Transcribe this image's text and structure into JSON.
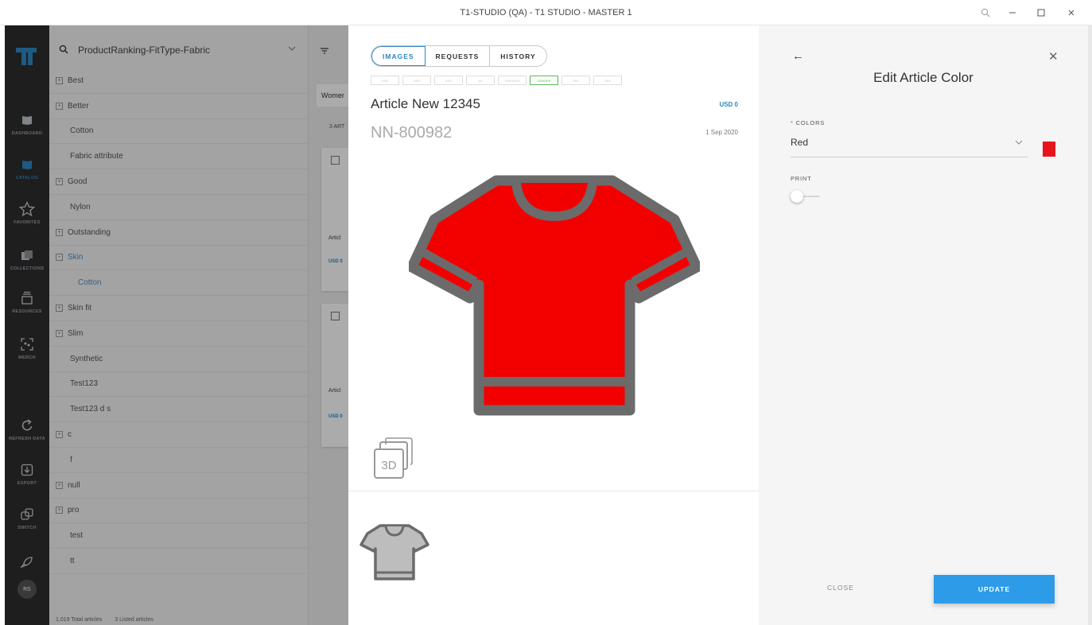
{
  "window": {
    "title": "T1-STUDIO (QA) - T1 STUDIO - MASTER 1"
  },
  "rail": {
    "items": [
      {
        "label": "DASHBOARD"
      },
      {
        "label": "CATALOG"
      },
      {
        "label": "FAVORITES"
      },
      {
        "label": "COLLECTIONS"
      },
      {
        "label": "RESOURCES"
      },
      {
        "label": "MERCH"
      },
      {
        "label": "REFRESH DATA"
      },
      {
        "label": "EXPORT"
      },
      {
        "label": "SWITCH"
      }
    ],
    "avatar": "RS"
  },
  "tree": {
    "search_value": "ProductRanking-FitType-Fabric",
    "items": [
      {
        "label": "Best"
      },
      {
        "label": "Better"
      },
      {
        "label": "Cotton"
      },
      {
        "label": "Fabric attribute"
      },
      {
        "label": "Good"
      },
      {
        "label": "Nylon"
      },
      {
        "label": "Outstanding"
      },
      {
        "label": "Skin"
      },
      {
        "label": "Cotton"
      },
      {
        "label": "Skin fit"
      },
      {
        "label": "Slim"
      },
      {
        "label": "Synthetic"
      },
      {
        "label": "Test123"
      },
      {
        "label": "Test123 d s"
      },
      {
        "label": "c"
      },
      {
        "label": "f"
      },
      {
        "label": "null"
      },
      {
        "label": "pro"
      },
      {
        "label": "test"
      },
      {
        "label": "tt"
      }
    ],
    "footer_total": "1,019 Total articles",
    "footer_listed": "3 Listed articles"
  },
  "midcol": {
    "segment": "Womer",
    "count": "3 ART",
    "card1": {
      "name": "Articl",
      "price": "USD 0"
    },
    "card2": {
      "name": "Articl",
      "price": "USD 0"
    }
  },
  "article": {
    "tabs": [
      "IMAGES",
      "REQUESTS",
      "HISTORY"
    ],
    "active_tab": "IMAGES",
    "chips": [
      "XXX",
      "XXX",
      "XXX",
      "XX",
      "XXXXXXX",
      "GENDER",
      "XXX",
      "XXX"
    ],
    "active_chip": "GENDER",
    "title": "Article New 12345",
    "price": "USD 0",
    "code": "NN-800982",
    "date": "1 Sep 2020",
    "badge_3d": "3D",
    "colors": {
      "shirt": "#f20000",
      "outline": "#6b6b6b",
      "thumb_fill": "#bdbdbd"
    }
  },
  "edit": {
    "title": "Edit Article Color",
    "colors_label": "COLORS",
    "colors_required_mark": "*",
    "color_value": "Red",
    "swatch_color": "#e8141c",
    "print_label": "PRINT",
    "print_on": false,
    "close_label": "CLOSE",
    "update_label": "UPDATE"
  }
}
